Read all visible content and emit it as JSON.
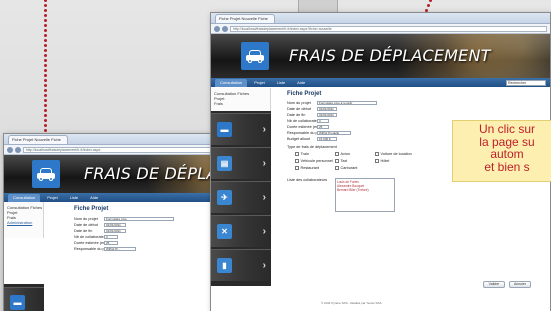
{
  "app_title": "FRAIS DE DÉPLACEMENT",
  "back_window": {
    "tab_label": "Fiche Projet Nouvelle Fiche",
    "url": "http://localhost/fraisdeplacement/fr-fr/index.aspx",
    "menu": [
      "Consultation",
      "Projet",
      "Liste",
      "Aide"
    ],
    "sidebar": [
      "Consultation Fiches",
      "Projet",
      "Frais",
      "Administration"
    ],
    "form_title": "Fiche Projet",
    "fields": [
      {
        "label": "Nom du projet",
        "value": "Formulaire type"
      },
      {
        "label": "Date de début",
        "value": "01/01/2011"
      },
      {
        "label": "Date de fin",
        "value": "31/01/2011"
      },
      {
        "label": "Nb de collaborateurs prévus",
        "value": "3"
      },
      {
        "label": "Durée estimée (en jours/homme)",
        "value": "25"
      },
      {
        "label": "Responsable du projet",
        "value": "Wilfrid Pr..."
      }
    ]
  },
  "front_window": {
    "tab_label": "Fiche Projet Nouvelle Fiche",
    "url": "http://localhost/fraisdeplacement/fr-fr/index.aspx?fiche=nouvelle",
    "menu": [
      "Consultation",
      "Projet",
      "Liste",
      "Aide"
    ],
    "search_placeholder": "Rechercher",
    "sidebar": [
      "Consultation Fiches",
      "Projet",
      "Frais"
    ],
    "form_title": "Fiche Projet",
    "fields": [
      {
        "label": "Nom du projet",
        "value": "Formulaire type à remplir"
      },
      {
        "label": "Date de début",
        "value": "01/01/2011"
      },
      {
        "label": "Date de fin",
        "value": "31/01/2011"
      },
      {
        "label": "Nb de collaborateurs prévus",
        "value": "3"
      },
      {
        "label": "Durée estimée (en jours/homme)",
        "value": "25"
      },
      {
        "label": "Responsable du projet",
        "value": "Wilfrid Prudelle"
      },
      {
        "label": "Budget alloué",
        "value": "15 000 €"
      }
    ],
    "options_heading": "Type de frais de déplacement",
    "options": [
      "Train",
      "Avion",
      "Voiture de location",
      "Véhicule personnel",
      "Taxi",
      "Hôtel",
      "Restaurant",
      "Carburant"
    ],
    "collab_label": "Liste des collaborateurs",
    "collab_list": [
      "Louis de Funès",
      "Alexandre Bouquet",
      "Bernard Blier (Torture)"
    ],
    "buttons": {
      "ok": "Valider",
      "cancel": "Annuler"
    },
    "footer": "© 2011 Pyrène SAS - Réalisé par Yenan SAS"
  },
  "callout_lines": [
    "Un clic sur",
    "la page su",
    "autom",
    "et bien s"
  ],
  "tile_icons": [
    "car-icon",
    "document-icon",
    "plane-icon",
    "tools-icon",
    "book-icon"
  ],
  "colors": {
    "accent": "#2d78c8",
    "callout_bg": "#fcefb0",
    "callout_text": "#c01f28",
    "dotted_path": "#b3202a"
  }
}
